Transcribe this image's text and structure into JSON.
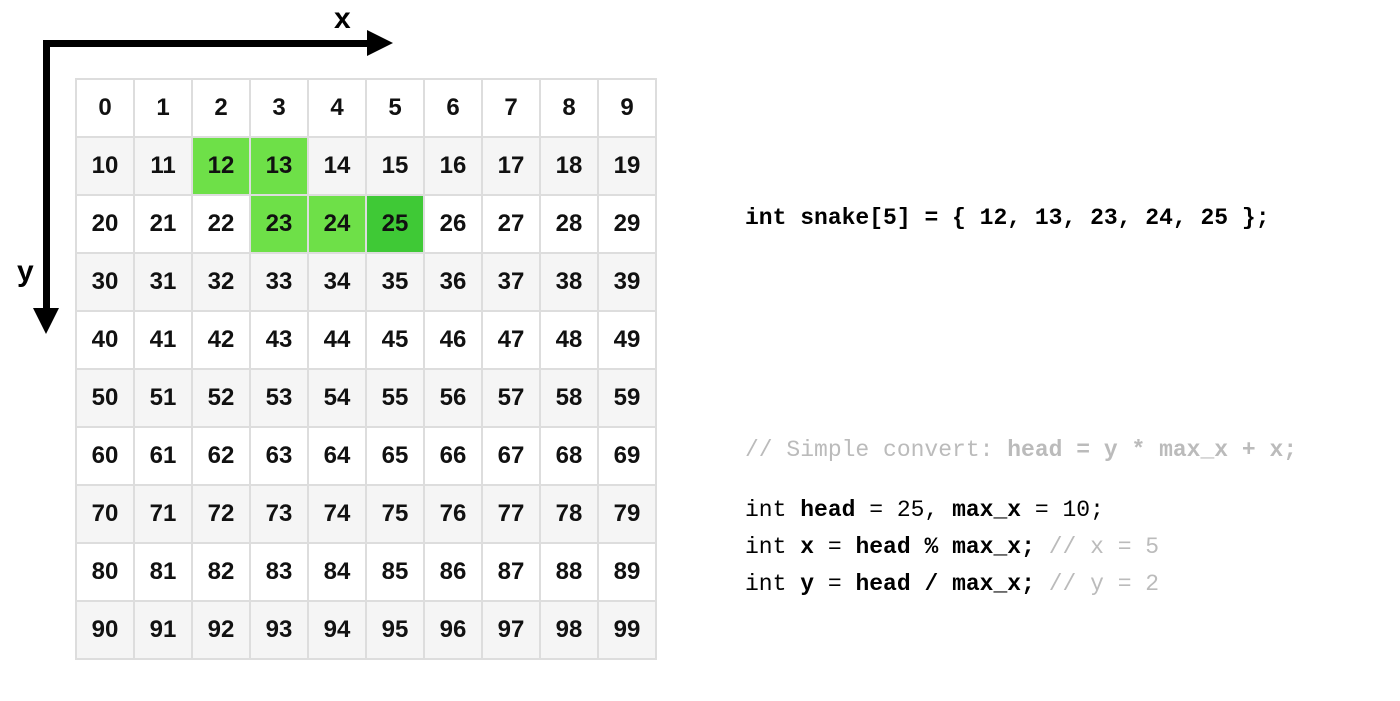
{
  "axes": {
    "x_label": "x",
    "y_label": "y"
  },
  "grid": {
    "cols": 10,
    "rows": 10,
    "snake_body": [
      12,
      13,
      23,
      24
    ],
    "snake_head": 25
  },
  "code": {
    "kw_int1": "int",
    "snake_decl_rest": " snake[5] = { 12, 13, 23, 24, 25 };",
    "comment_prefix": "// Simple convert: ",
    "comment_expr": "head = y * max_x + x;",
    "line_int_a": "int ",
    "line_head": "head",
    "line_eq25": " = 25, ",
    "line_maxx": "max_x",
    "line_eq10": " = 10;",
    "line_int_b": "int ",
    "line_x": "x",
    "line_x_expr": " = ",
    "line_x_rhs": "head % max_x;",
    "line_x_cmt": " // x = 5",
    "line_int_c": "int ",
    "line_y": "y",
    "line_y_expr": " = ",
    "line_y_rhs": "head / max_x;",
    "line_y_cmt": " // y = 2"
  }
}
